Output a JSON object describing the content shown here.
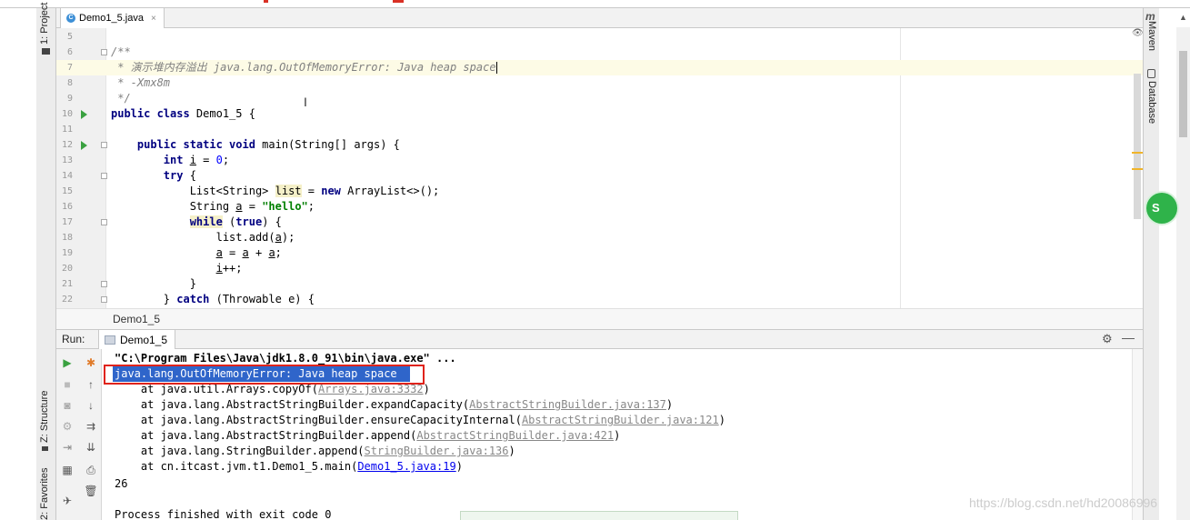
{
  "editor_tab": {
    "label": "Demo1_5.java",
    "close": "×"
  },
  "left_tool_tabs": {
    "project": "1: Project",
    "structure": "Z: Structure",
    "favorites": "2: Favorites"
  },
  "right_tool_tabs": {
    "maven_logo": "m",
    "maven": "Maven",
    "database": "Database"
  },
  "green_button": {
    "label": "S"
  },
  "editor": {
    "lines": [
      {
        "num": "5",
        "html": ""
      },
      {
        "num": "6",
        "html": "<span class=\"cmt\">/**</span>"
      },
      {
        "num": "7",
        "html": "<span class=\"cmt\"> * 演示堆内存溢出 java.lang.OutOfMemoryError: Java heap space</span><span class=\"caret\"></span>"
      },
      {
        "num": "8",
        "html": "<span class=\"cmt\"> * -Xmx8m</span>"
      },
      {
        "num": "9",
        "html": "<span class=\"cmt\"> */</span>"
      },
      {
        "num": "10",
        "html": "<span class=\"kw\">public class</span> Demo1_5 {"
      },
      {
        "num": "11",
        "html": ""
      },
      {
        "num": "12",
        "html": "    <span class=\"kw\">public static void</span> main(String[] args) {"
      },
      {
        "num": "13",
        "html": "        <span class=\"kw\">int</span> <span class=\"ul\">i</span> = <span class=\"num\">0</span>;"
      },
      {
        "num": "14",
        "html": "        <span class=\"kw\">try</span> {"
      },
      {
        "num": "15",
        "html": "            List&lt;String&gt; <span class=\"hl-var\">list</span> = <span class=\"kw\">new</span> ArrayList&lt;&gt;();"
      },
      {
        "num": "16",
        "html": "            String <span class=\"ul\">a</span> = <span class=\"str\">\"hello\"</span>;"
      },
      {
        "num": "17",
        "html": "            <span class=\"kw hl-var\">while</span> (<span class=\"kw\">true</span>) {"
      },
      {
        "num": "18",
        "html": "                list.add(<span class=\"ul\">a</span>);"
      },
      {
        "num": "19",
        "html": "                <span class=\"ul\">a</span> = <span class=\"ul\">a</span> + <span class=\"ul\">a</span>;"
      },
      {
        "num": "20",
        "html": "                <span class=\"ul\">i</span>++;"
      },
      {
        "num": "21",
        "html": "            }"
      },
      {
        "num": "22",
        "html": "        } <span class=\"kw\">catch</span> (Throwable e) {"
      }
    ],
    "run_lines": [
      "10",
      "12"
    ],
    "fold_lines": [
      "6",
      "12",
      "14",
      "17",
      "21",
      "22"
    ],
    "current_line": "7"
  },
  "breadcrumb": {
    "label": "Demo1_5"
  },
  "run_panel": {
    "label": "Run:",
    "tab_label": "Demo1_5",
    "console": {
      "command": "\"C:\\Program Files\\Java\\jdk1.8.0_91\\bin\\java.exe\" ...",
      "error": "java.lang.OutOfMemoryError: Java heap space",
      "stack": [
        {
          "prefix": "    at java.util.Arrays.copyOf(",
          "link": "Arrays.java:3332",
          "link_style": "grey",
          "suffix": ")"
        },
        {
          "prefix": "    at java.lang.AbstractStringBuilder.expandCapacity(",
          "link": "AbstractStringBuilder.java:137",
          "link_style": "grey",
          "suffix": ")"
        },
        {
          "prefix": "    at java.lang.AbstractStringBuilder.ensureCapacityInternal(",
          "link": "AbstractStringBuilder.java:121",
          "link_style": "grey",
          "suffix": ")"
        },
        {
          "prefix": "    at java.lang.AbstractStringBuilder.append(",
          "link": "AbstractStringBuilder.java:421",
          "link_style": "grey",
          "suffix": ")"
        },
        {
          "prefix": "    at java.lang.StringBuilder.append(",
          "link": "StringBuilder.java:136",
          "link_style": "grey",
          "suffix": ")"
        },
        {
          "prefix": "    at cn.itcast.jvm.t1.Demo1_5.main(",
          "link": "Demo1_5.java:19",
          "link_style": "blue",
          "suffix": ")"
        }
      ],
      "output": "26",
      "exit": "Process finished with exit code 0"
    }
  },
  "watermark": "https://blog.csdn.net/hd20086996",
  "colors": {
    "accent_red": "#e0231b",
    "selection_blue": "#2f65ca",
    "run_green": "#3aa140"
  }
}
